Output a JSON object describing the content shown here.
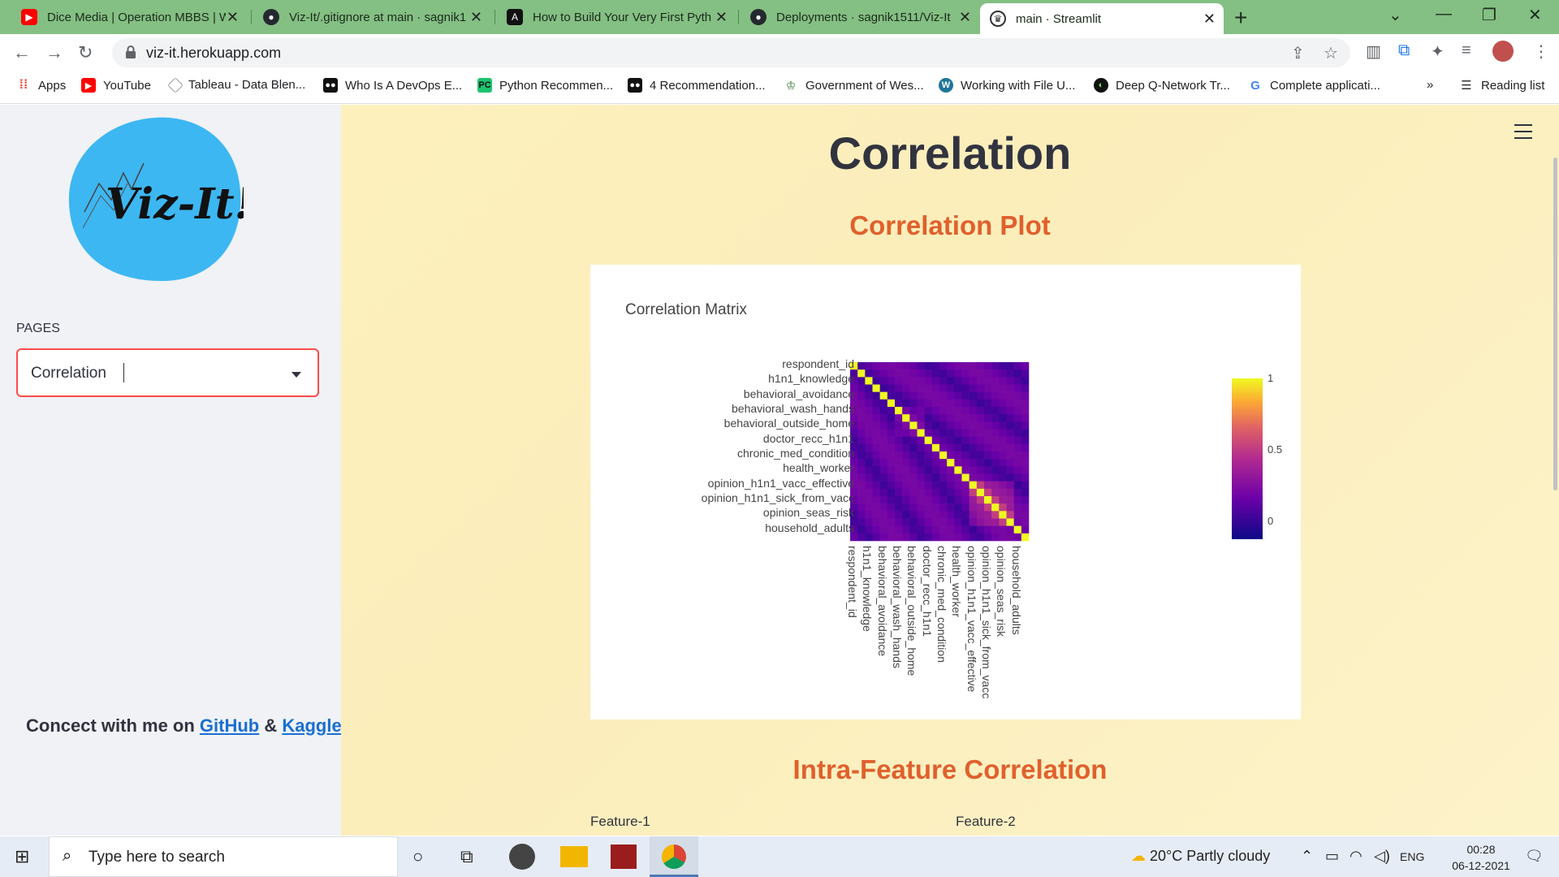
{
  "browser": {
    "tabs": [
      {
        "title": "Dice Media | Operation MBBS | W",
        "favicon": "youtube-icon"
      },
      {
        "title": "Viz-It/.gitignore at main · sagnik1",
        "favicon": "github-icon"
      },
      {
        "title": "How to Build Your Very First Pyth",
        "favicon": "analytics-vidhya-icon"
      },
      {
        "title": "Deployments · sagnik1511/Viz-It",
        "favicon": "github-icon"
      },
      {
        "title": "main · Streamlit",
        "favicon": "streamlit-icon"
      }
    ],
    "url": "viz-it.herokuapp.com",
    "bookmarks": [
      "Apps",
      "YouTube",
      "Tableau - Data Blen...",
      "Who Is A DevOps E...",
      "Python Recommen...",
      "4 Recommendation...",
      "Government of Wes...",
      "Working with File U...",
      "Deep Q-Network Tr...",
      "Complete applicati..."
    ],
    "reading_list": "Reading list",
    "more": "»"
  },
  "sidebar": {
    "logo_text": "Viz-It!",
    "pages_label": "PAGES",
    "selected_page": "Correlation",
    "connect_prefix": "Concect with me on ",
    "github": "GitHub",
    "amp": " & ",
    "kaggle": "Kaggle"
  },
  "main": {
    "title": "Correlation",
    "section1": "Correlation Plot",
    "section2": "Intra-Feature Correlation",
    "feature1": "Feature-1",
    "feature2": "Feature-2"
  },
  "chart_data": {
    "type": "heatmap",
    "title": "Correlation Matrix",
    "colorscale": "plasma",
    "zlim": [
      0,
      1
    ],
    "colorbar_ticks": [
      "1",
      "0.5",
      "0"
    ],
    "y_tick_labels": [
      "respondent_id",
      "h1n1_knowledge",
      "behavioral_avoidance",
      "behavioral_wash_hands",
      "behavioral_outside_home",
      "doctor_recc_h1n1",
      "chronic_med_condition",
      "health_worker",
      "opinion_h1n1_vacc_effective",
      "opinion_h1n1_sick_from_vacc",
      "opinion_seas_risk",
      "household_adults"
    ],
    "x_tick_labels": [
      "respondent_id",
      "h1n1_knowledge",
      "behavioral_avoidance",
      "behavioral_wash_hands",
      "behavioral_outside_home",
      "doctor_recc_h1n1",
      "chronic_med_condition",
      "health_worker",
      "opinion_h1n1_vacc_effective",
      "opinion_h1n1_sick_from_vacc",
      "opinion_seas_risk",
      "household_adults"
    ],
    "n": 24
  },
  "taskbar": {
    "search_placeholder": "Type here to search",
    "weather": "20°C  Partly cloudy",
    "lang": "ENG",
    "time": "00:28",
    "date": "06-12-2021"
  }
}
